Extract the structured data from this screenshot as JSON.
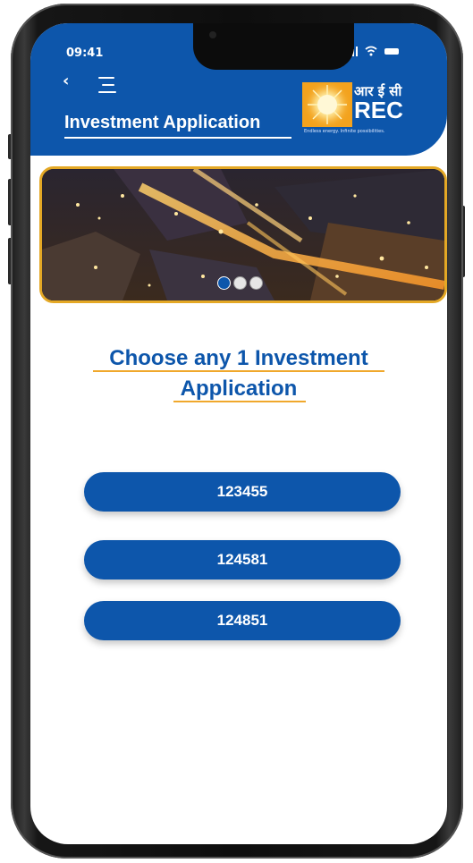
{
  "status_bar": {
    "time": "09:41"
  },
  "header": {
    "title": "Investment Application",
    "logo": {
      "hindi_name": "आर ई सी",
      "name": "REC",
      "tagline": "Endless energy. Infinite possibilities."
    }
  },
  "banner": {
    "slide_count": 3,
    "active_slide": 1
  },
  "prompt": {
    "line1": "Choose any 1 Investment",
    "line2": "Application"
  },
  "applications": [
    {
      "label": "123455"
    },
    {
      "label": "124581"
    },
    {
      "label": "124851"
    }
  ],
  "colors": {
    "primary": "#0d56ab",
    "accent": "#f0a82c"
  },
  "icons": [
    "back-chevron-icon",
    "hamburger-menu-icon",
    "signal-icon",
    "wifi-icon",
    "battery-icon"
  ]
}
